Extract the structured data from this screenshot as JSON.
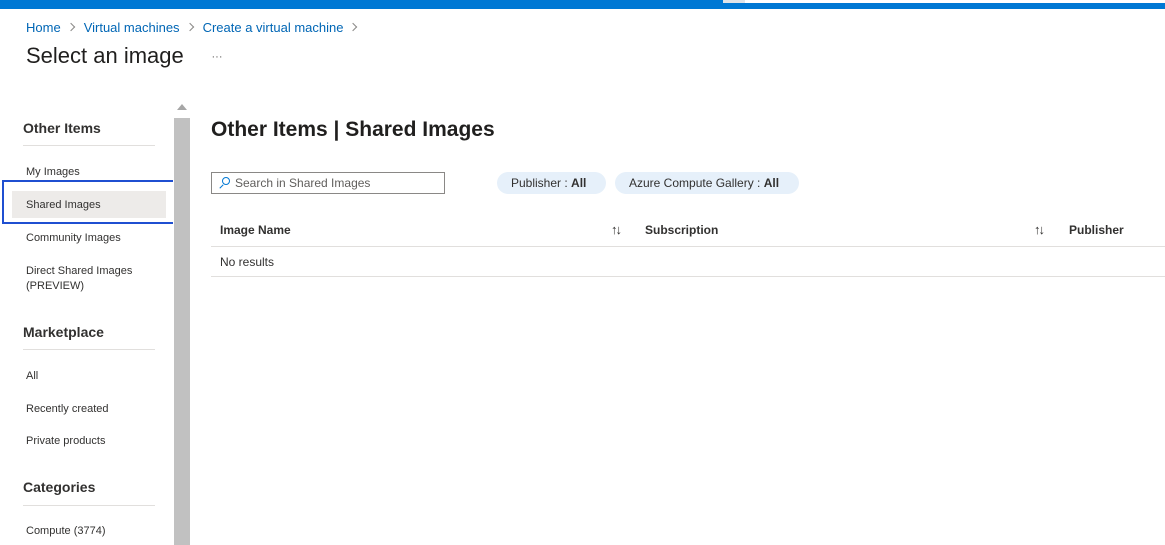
{
  "breadcrumb": {
    "items": [
      "Home",
      "Virtual machines",
      "Create a virtual machine"
    ]
  },
  "page": {
    "title": "Select an image",
    "more_label": "···"
  },
  "sidebar": {
    "sections": [
      {
        "header": "Other Items",
        "items": [
          "My Images",
          "Shared Images",
          "Community Images",
          "Direct Shared Images (PREVIEW)"
        ]
      },
      {
        "header": "Marketplace",
        "items": [
          "All",
          "Recently created",
          "Private products"
        ]
      },
      {
        "header": "Categories",
        "items": [
          "Compute (3774)"
        ]
      }
    ],
    "selected_item": "Shared Images"
  },
  "main": {
    "title": "Other Items | Shared Images",
    "search": {
      "placeholder": "Search in Shared Images",
      "value": ""
    },
    "filters": [
      {
        "label": "Publisher : ",
        "value": "All"
      },
      {
        "label": "Azure Compute Gallery : ",
        "value": "All"
      }
    ],
    "table": {
      "columns": [
        "Image Name",
        "Subscription",
        "Publisher"
      ],
      "sort_glyph": "↑↓",
      "empty_text": "No results"
    }
  },
  "colors": {
    "brand": "#0078d4",
    "link": "#0066b5",
    "focus": "#1f4fd1",
    "pill": "#e6f0fa",
    "selected": "#edebe9"
  },
  "icons": [
    "search-icon",
    "chevron-right-icon",
    "ellipsis-icon",
    "sort-icon",
    "scroll-up-arrow-icon"
  ]
}
